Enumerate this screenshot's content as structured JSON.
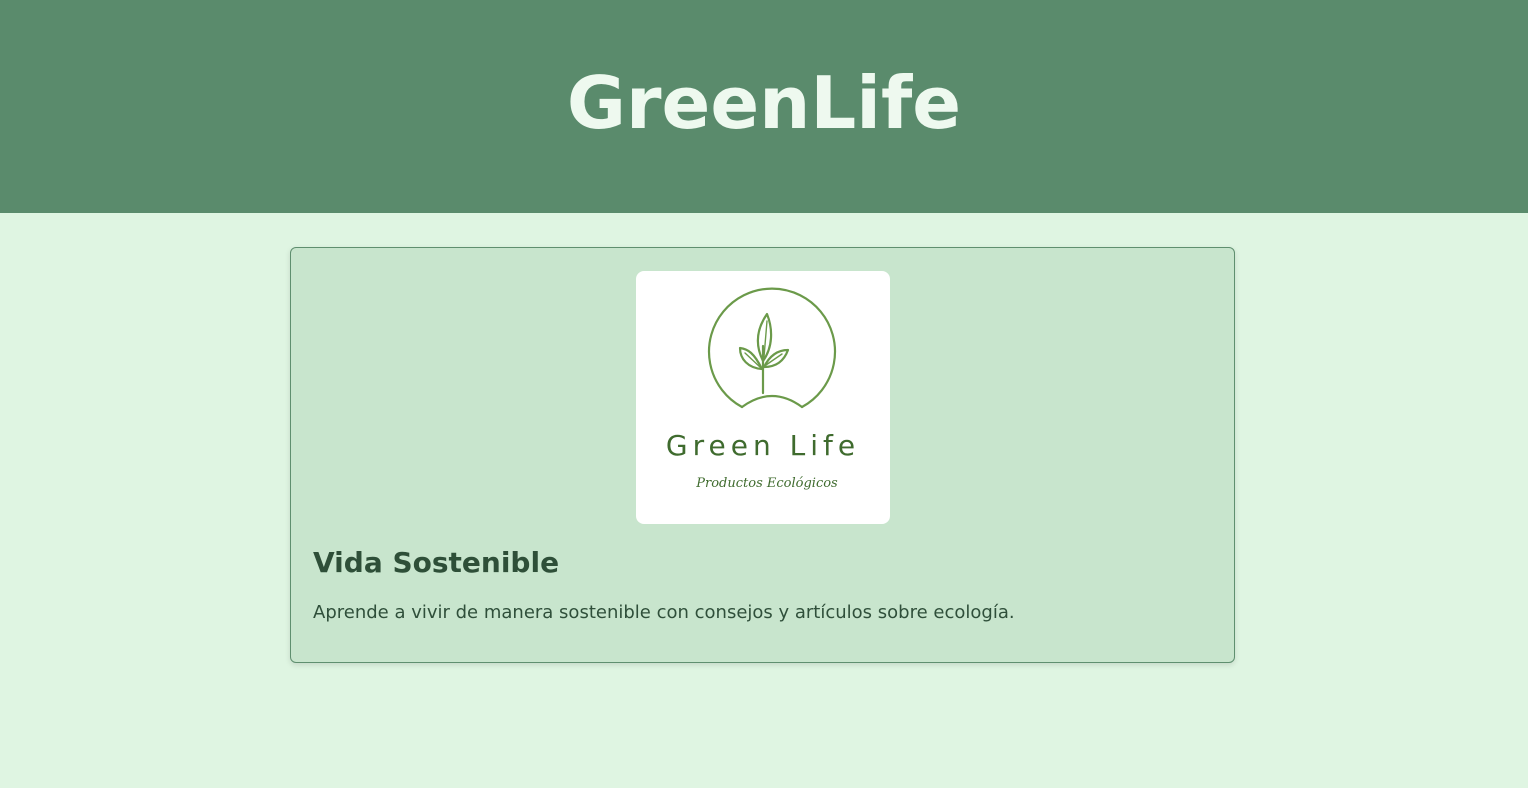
{
  "header": {
    "title": "GreenLife"
  },
  "card": {
    "logo": {
      "brand_name": "Green Life",
      "tagline": "Productos Ecológicos",
      "icon": "sprout-icon"
    },
    "title": "Vida Sostenible",
    "description": "Aprende a vivir de manera sostenible con consejos y artículos sobre ecología."
  },
  "colors": {
    "header_bg": "#5a8b6c",
    "page_bg": "#dff5e2",
    "card_bg": "#c8e5cd",
    "logo_green": "#6b9a4a",
    "logo_text": "#3f6b2e"
  }
}
